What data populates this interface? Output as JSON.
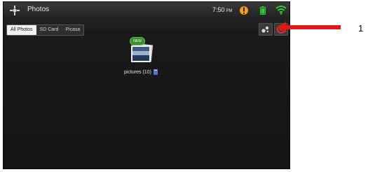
{
  "statusbar": {
    "app_title": "Photos",
    "clock_time": "7:50",
    "clock_ampm": "PM"
  },
  "tabs": [
    {
      "label": "All Photos",
      "selected": true
    },
    {
      "label": "SD Card",
      "selected": false
    },
    {
      "label": "Picasa",
      "selected": false
    }
  ],
  "album": {
    "badge": "NEW",
    "caption": "pictures (10)"
  },
  "annotation": {
    "number": "1",
    "arrow_color": "#e01818"
  },
  "icons": {
    "app": "photos-gallery-icon",
    "alert": "alert-icon",
    "battery": "battery-icon",
    "wifi": "wifi-icon",
    "slideshow": "slideshow-icon",
    "camera": "camera-icon",
    "sd": "sd-card-icon"
  },
  "colors": {
    "wifi": "#2fd12f",
    "battery": "#2fd12f",
    "alert": "#f0a020"
  }
}
